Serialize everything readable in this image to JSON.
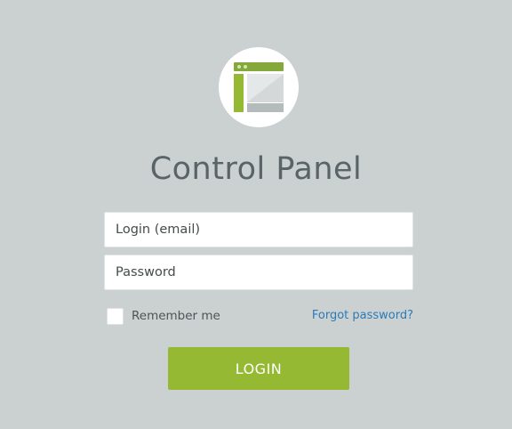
{
  "app": {
    "title": "Control Panel",
    "logo_icon": "browser-window-icon",
    "accent_color": "#95b932",
    "background_color": "#cbd0d0",
    "link_color": "#2b7ab8"
  },
  "form": {
    "email_placeholder": "Login (email)",
    "password_placeholder": "Password",
    "remember_label": "Remember me",
    "remember_checked": false,
    "forgot_label": "Forgot password?",
    "login_label": "LOGIN"
  }
}
